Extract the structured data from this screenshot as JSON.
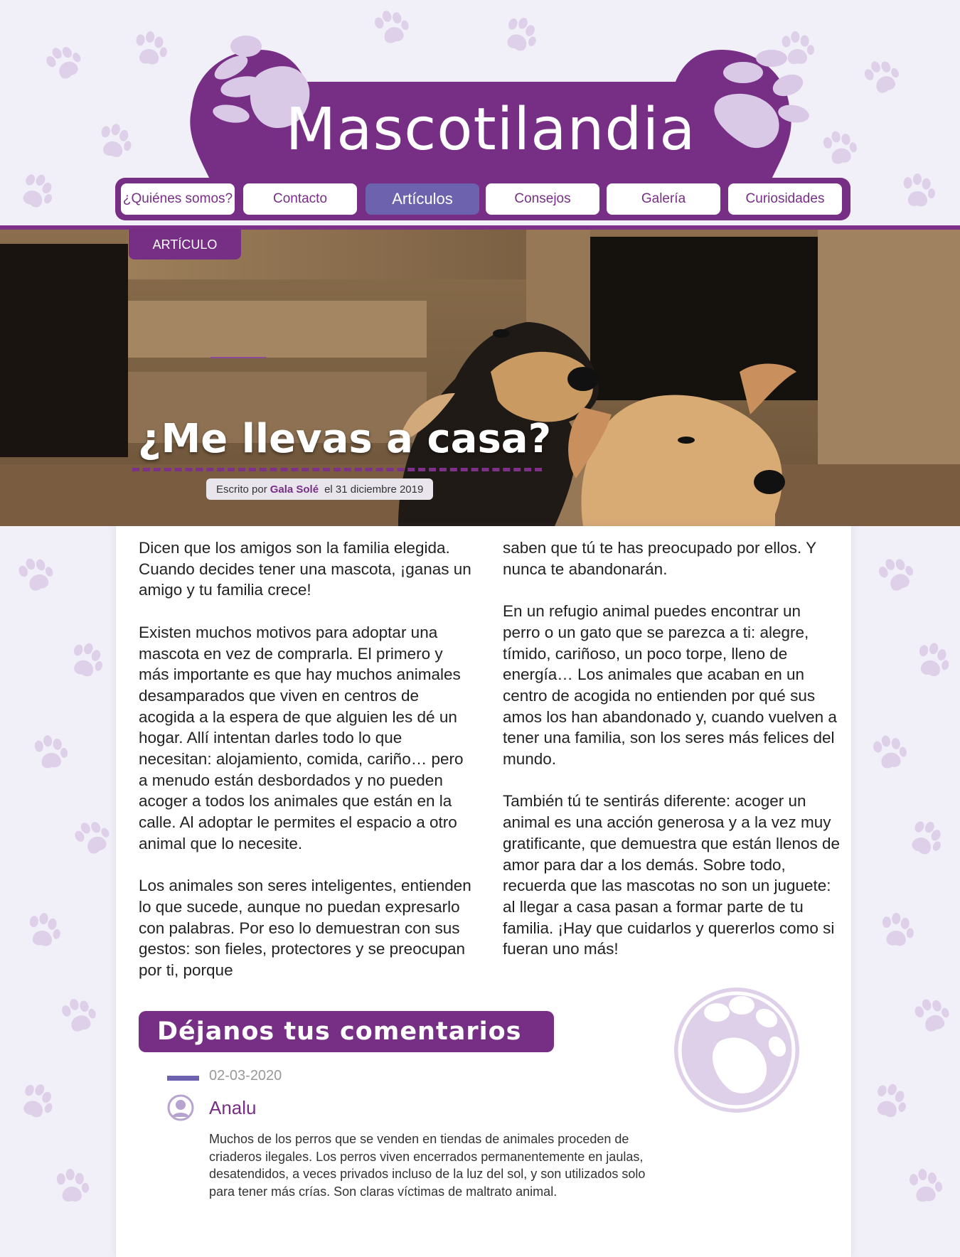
{
  "site": {
    "title": "Mascotilandia"
  },
  "nav": {
    "items": [
      {
        "label": "¿Quiénes somos?"
      },
      {
        "label": "Contacto"
      },
      {
        "label": "Artículos"
      },
      {
        "label": "Consejos"
      },
      {
        "label": "Galería"
      },
      {
        "label": "Curiosidades"
      }
    ],
    "active": "Artículos"
  },
  "hero": {
    "tag": "ARTÍCULO",
    "title": "¿Me llevas a casa?",
    "byline_prefix": "Escrito por",
    "author": "Gala Solé",
    "date": "el 31 diciembre 2019"
  },
  "article": {
    "left": [
      "Dicen que los amigos son la familia elegida. Cuando decides tener una mascota, ¡ganas un amigo y tu familia crece!",
      "Existen muchos motivos para adoptar una mascota en vez de comprarla. El primero y más importante es que hay muchos animales desamparados que viven en centros de acogida a la espera de que alguien les dé un hogar. Allí intentan darles todo lo que necesitan: alojamiento, comida, cariño… pero a menudo están desbordados y no pueden acoger a todos los animales que están en la calle. Al adoptar le permites el espacio a otro animal que lo necesite.",
      "Los animales son seres inteligentes, entienden lo que sucede, aunque no puedan expresarlo con palabras. Por eso lo demuestran con sus gestos: son fieles, protectores y se preocupan por ti, porque"
    ],
    "right": [
      "saben que tú te has preocupado por ellos. Y nunca te abandonarán.",
      "En un refugio animal puedes encontrar un perro o un gato que se parezca a ti: alegre, tímido, cariñoso, un poco torpe, lleno de energía… Los animales que acaban en un centro de acogida no entienden por qué sus amos los han abandonado y, cuando vuelven a tener una familia, son los seres más felices del mundo.",
      "También tú te sentirás diferente: acoger un animal es una acción generosa y a la vez muy gratificante, que demuestra que están llenos de amor para dar a los demás. Sobre todo, recuerda que las mascotas no son un juguete: al llegar a casa pasan a formar parte de tu familia. ¡Hay que cuidarlos y quererlos como si fueran uno más!"
    ]
  },
  "comments": {
    "title": "Déjanos tus comentarios",
    "items": [
      {
        "date": "02-03-2020",
        "author": "Analu",
        "text": "Muchos de los perros que se venden en tiendas de animales proceden de criaderos ilegales. Los perros viven encerrados permanentemente en jaulas, desatendidos, a veces privados incluso de la luz del sol, y son utilizados solo para tener más crías. Son claras víctimas de maltrato animal."
      }
    ]
  },
  "colors": {
    "brand": "#772f86",
    "accent": "#6c62ad",
    "paw_light": "#d9c8e6",
    "bg": "#f1eff8"
  },
  "icons": {
    "paw": "paw-icon",
    "avatar": "user-avatar-icon"
  }
}
